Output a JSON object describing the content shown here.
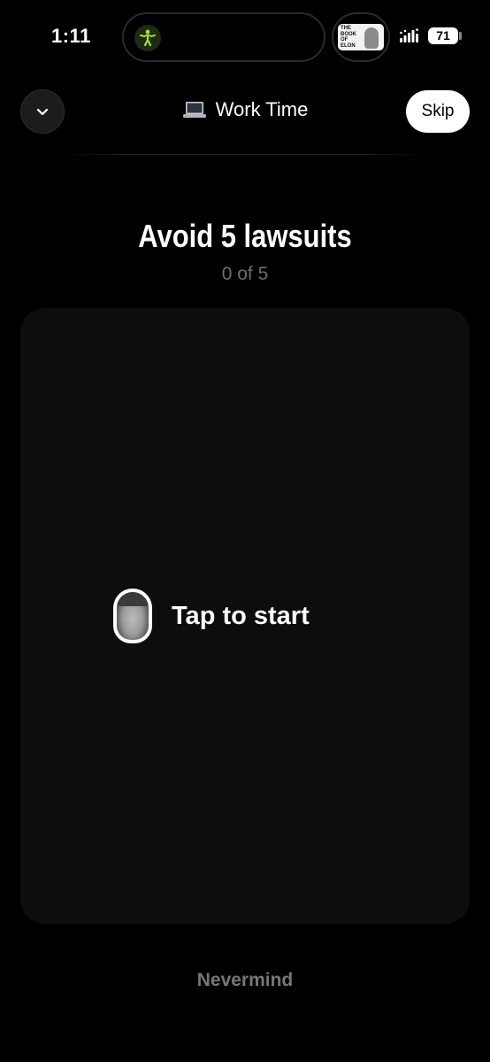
{
  "status_bar": {
    "time": "1:11",
    "battery_level": "71",
    "album_title": "THE BOOK OF ELON",
    "activity_icon": "fitness-figure-icon",
    "accent_color": "#9be22d"
  },
  "header": {
    "collapse_icon": "chevron-down-icon",
    "emoji": "💻",
    "title": "Work Time",
    "skip_label": "Skip"
  },
  "task": {
    "title": "Avoid 5 lawsuits",
    "progress": "0 of 5",
    "completed": 0,
    "total": 5
  },
  "card": {
    "prompt": "Tap to start",
    "avatar_icon": "face-sticker-icon"
  },
  "footer": {
    "dismiss_label": "Nevermind"
  }
}
